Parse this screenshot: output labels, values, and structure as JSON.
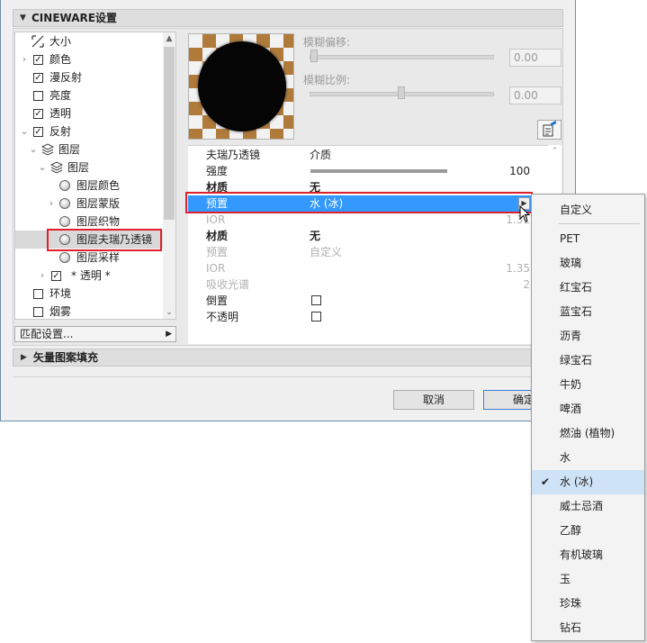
{
  "section_header": {
    "title": "CINEWARE设置"
  },
  "tree": {
    "items": [
      {
        "label": "大小",
        "type": "size-icon"
      },
      {
        "label": "颜色",
        "type": "checkbox",
        "checked": true,
        "expand": true
      },
      {
        "label": "漫反射",
        "type": "checkbox",
        "checked": true
      },
      {
        "label": "亮度",
        "type": "checkbox",
        "checked": false
      },
      {
        "label": "透明",
        "type": "checkbox",
        "checked": true
      },
      {
        "label": "反射",
        "type": "checkbox",
        "checked": true,
        "expanded": true
      },
      {
        "label": "图层",
        "type": "layer-icon"
      },
      {
        "label": "图层",
        "type": "layer-icon"
      },
      {
        "label": "图层颜色",
        "type": "radio"
      },
      {
        "label": "图层蒙版",
        "type": "radio",
        "expand": true
      },
      {
        "label": "图层织物",
        "type": "radio"
      },
      {
        "label": "图层夫瑞乃透镜",
        "type": "radio",
        "selected": true
      },
      {
        "label": "图层采样",
        "type": "radio"
      },
      {
        "label": "* 透明 *",
        "type": "checkbox",
        "checked": true,
        "expand": true
      },
      {
        "label": "环境",
        "type": "checkbox",
        "checked": false
      },
      {
        "label": "烟雾",
        "type": "checkbox",
        "checked": false
      }
    ],
    "match_button": "匹配设置..."
  },
  "blur": {
    "offset_label": "模糊偏移:",
    "offset_value": "0.00",
    "scale_label": "模糊比例:",
    "scale_value": "0.00"
  },
  "props": {
    "rows": [
      {
        "label": "夫瑞乃透镜",
        "value": "介质"
      },
      {
        "label": "强度",
        "right": "100",
        "level": 1.0
      },
      {
        "label": "材质",
        "value": "无",
        "bold": true
      },
      {
        "label": "预置",
        "value": "水 (冰)",
        "selected": true
      },
      {
        "label": "IOR",
        "right": "1.31",
        "disabled": true
      },
      {
        "label": "材质",
        "value": "无",
        "bold": true
      },
      {
        "label": "预置",
        "value": "自定义",
        "disabled": true
      },
      {
        "label": "IOR",
        "right": "1.35",
        "disabled": true
      },
      {
        "label": "吸收光谱",
        "right": "2",
        "disabled": true
      },
      {
        "label": "倒置",
        "checkbox": true
      },
      {
        "label": "不透明",
        "checkbox": true
      }
    ]
  },
  "bottom_section": {
    "title": "矢量图案填充"
  },
  "buttons": {
    "cancel": "取消",
    "ok": "确定"
  },
  "menu": {
    "items": [
      "自定义",
      "PET",
      "玻璃",
      "红宝石",
      "蓝宝石",
      "沥青",
      "绿宝石",
      "牛奶",
      "啤酒",
      "燃油 (植物)",
      "水",
      "水 (冰)",
      "威士忌酒",
      "乙醇",
      "有机玻璃",
      "玉",
      "珍珠",
      "钻石"
    ],
    "checked": "水 (冰)",
    "check_mark": "✔"
  },
  "colors": {
    "selection": "#3399ff",
    "highlight_box": "#e0202a",
    "menu_selected": "#cfe3f7"
  }
}
